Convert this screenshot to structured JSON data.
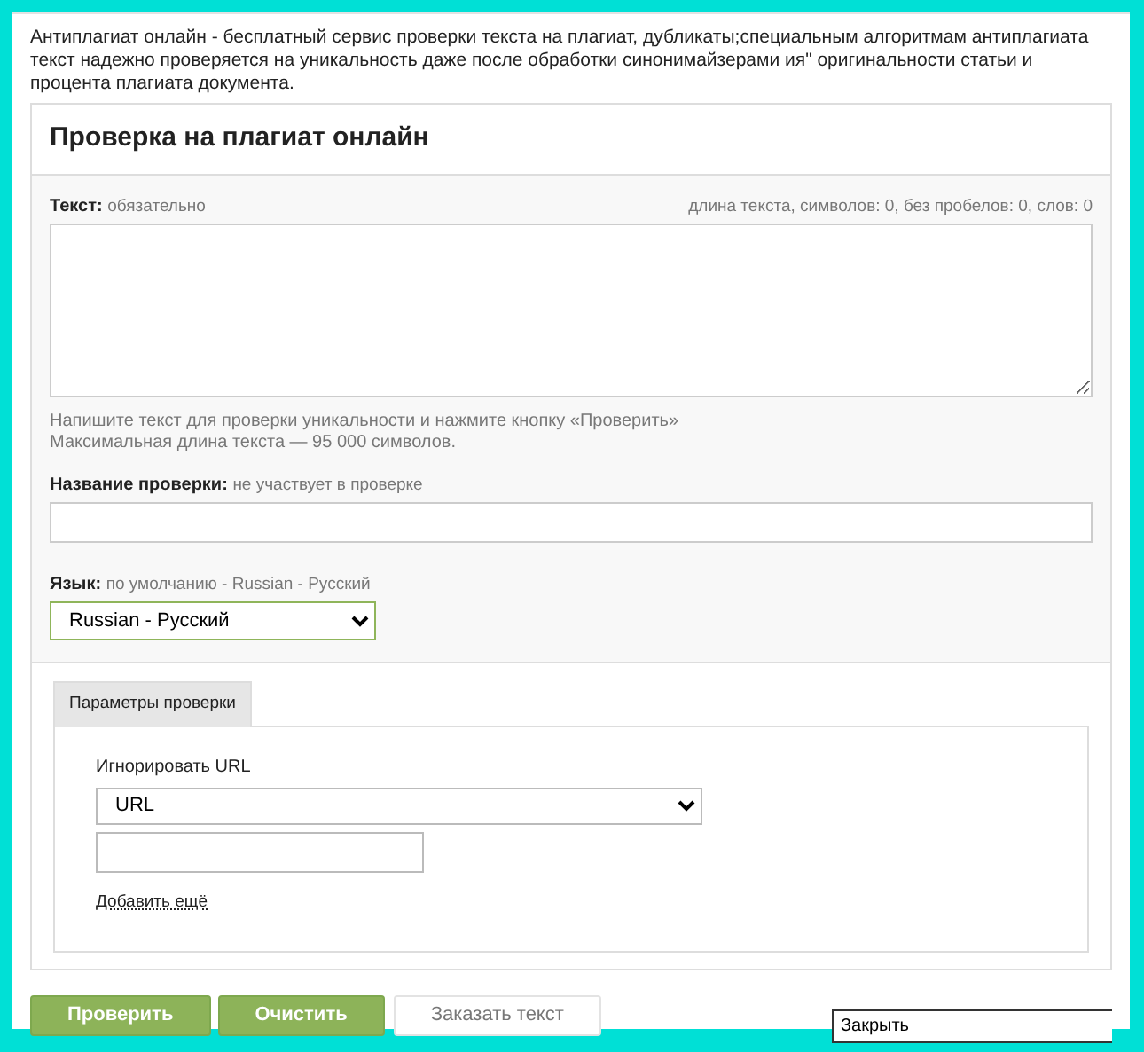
{
  "intro": "Антиплагиат онлайн - бесплатный сервис проверки текста на плагиат, дубликаты;специальным алгоритмам антиплагиата текст надежно проверяется на уникальность даже после обработки синонимайзерами ия\" оригинальности статьи и процента плагиата документа.",
  "form": {
    "title": "Проверка на плагиат онлайн",
    "text_label": "Текст:",
    "text_hint": "обязательно",
    "counter": "длина текста, символов: 0, без пробелов: 0, слов: 0",
    "help": [
      "Напишите текст для проверки уникальности и нажмите кнопку «Проверить»",
      "Максимальная длина текста — 95 000 символов."
    ],
    "name_label": "Название проверки:",
    "name_hint": "не участвует в проверке",
    "lang_label": "Язык:",
    "lang_hint": "по умолчанию - Russian - Русский",
    "lang_value": "Russian - Русский"
  },
  "tabs": [
    {
      "label": "Параметры проверки",
      "selected": true
    }
  ],
  "ignore": {
    "label": "Игнорировать URL",
    "select_value": "URL",
    "add_link": "Добавить ещё"
  },
  "buttons": [
    {
      "label": "Проверить",
      "kind": "primary"
    },
    {
      "label": "Очистить",
      "kind": "primary"
    },
    {
      "label": "Заказать текст",
      "kind": "secondary"
    }
  ],
  "close_field": {
    "value": "Закрыть"
  }
}
